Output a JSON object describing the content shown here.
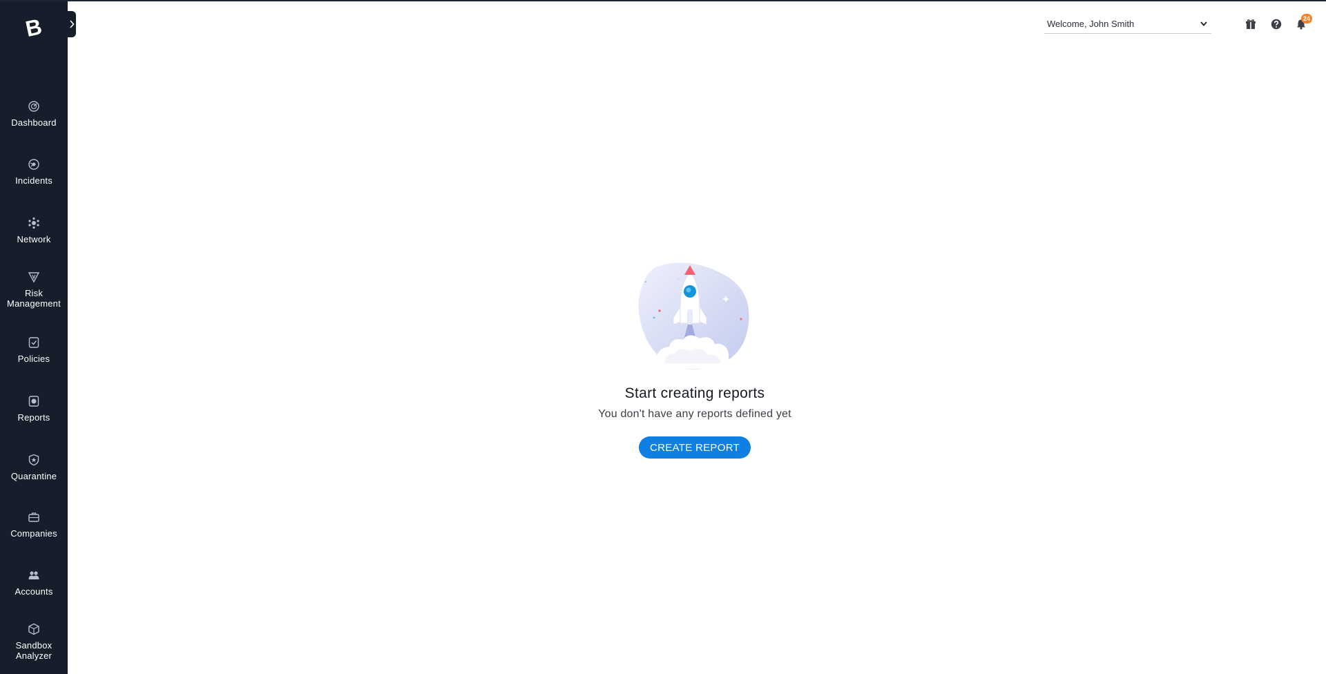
{
  "sidebar": {
    "logo_letter": "B",
    "items": [
      {
        "label": "Dashboard",
        "icon": "dashboard-icon"
      },
      {
        "label": "Incidents",
        "icon": "incidents-icon"
      },
      {
        "label": "Network",
        "icon": "network-icon"
      },
      {
        "label": "Risk Management",
        "icon": "risk-management-icon"
      },
      {
        "label": "Policies",
        "icon": "policies-icon"
      },
      {
        "label": "Reports",
        "icon": "reports-icon"
      },
      {
        "label": "Quarantine",
        "icon": "quarantine-icon"
      },
      {
        "label": "Companies",
        "icon": "companies-icon"
      },
      {
        "label": "Accounts",
        "icon": "accounts-icon"
      },
      {
        "label": "Sandbox Analyzer",
        "icon": "sandbox-analyzer-icon"
      }
    ]
  },
  "header": {
    "user_select": "Welcome, John Smith",
    "notifications_count": "24",
    "icons": [
      "gift-icon",
      "help-icon",
      "bell-icon"
    ]
  },
  "empty_state": {
    "title": "Start creating reports",
    "subtitle": "You don't have any reports defined yet",
    "button_label": "CREATE REPORT"
  },
  "colors": {
    "sidebar_bg": "#161d2b",
    "primary_button": "#0f7fe2",
    "badge": "#f5822a"
  }
}
